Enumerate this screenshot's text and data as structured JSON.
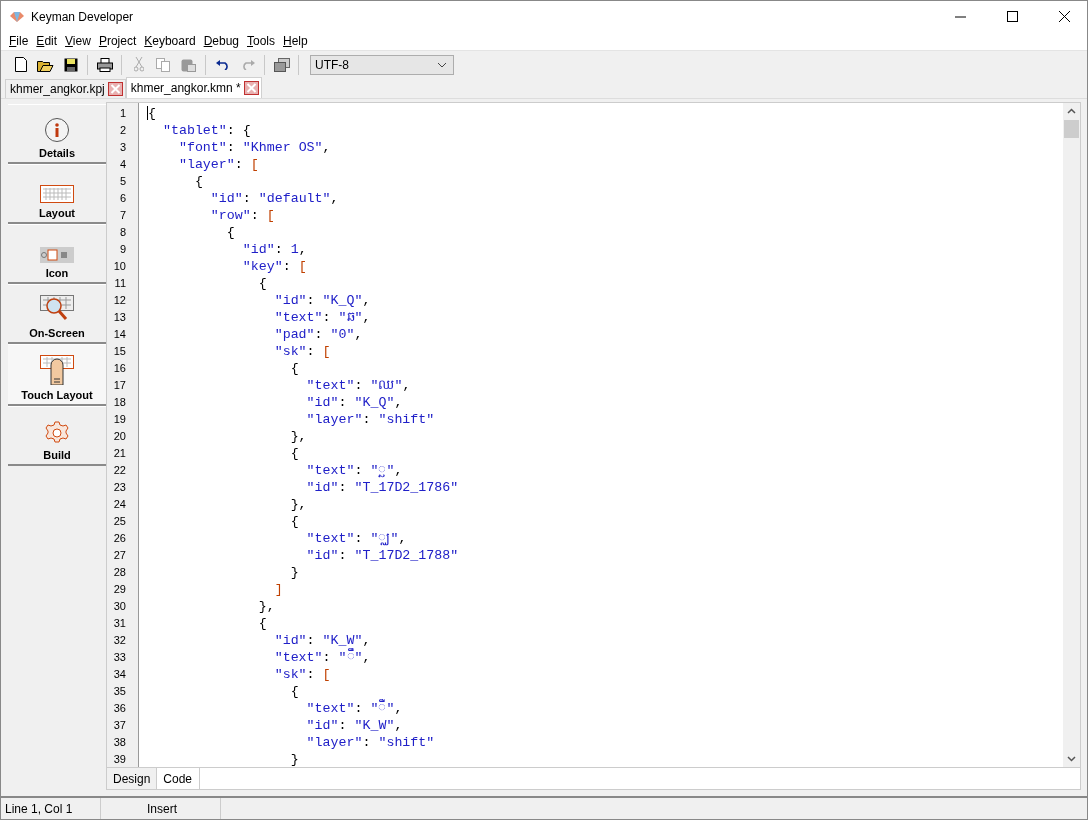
{
  "window": {
    "title": "Keyman Developer"
  },
  "menu": [
    "File",
    "Edit",
    "View",
    "Project",
    "Keyboard",
    "Debug",
    "Tools",
    "Help"
  ],
  "toolbar": {
    "encoding": "UTF-8"
  },
  "file_tabs": [
    {
      "label": "khmer_angkor.kpj",
      "selected": false
    },
    {
      "label": "khmer_angkor.kmn *",
      "selected": true
    }
  ],
  "sidebar": [
    {
      "label": "Details",
      "kind": "info",
      "selected": false
    },
    {
      "label": "Layout",
      "kind": "keyboard",
      "selected": false
    },
    {
      "label": "Icon",
      "kind": "icon",
      "selected": false
    },
    {
      "label": "On-Screen",
      "kind": "onscreen",
      "selected": false
    },
    {
      "label": "Touch Layout",
      "kind": "touch",
      "selected": true
    },
    {
      "label": "Build",
      "kind": "build",
      "selected": false
    }
  ],
  "editor": {
    "lines": [
      {
        "number": "1",
        "code": "{"
      },
      {
        "number": "2",
        "code": "  \"tablet\": {"
      },
      {
        "number": "3",
        "code": "    \"font\": \"Khmer OS\","
      },
      {
        "number": "4",
        "code": "    \"layer\": ["
      },
      {
        "number": "5",
        "code": "      {"
      },
      {
        "number": "6",
        "code": "        \"id\": \"default\","
      },
      {
        "number": "7",
        "code": "        \"row\": ["
      },
      {
        "number": "8",
        "code": "          {"
      },
      {
        "number": "9",
        "code": "            \"id\": 1,"
      },
      {
        "number": "10",
        "code": "            \"key\": ["
      },
      {
        "number": "11",
        "code": "              {"
      },
      {
        "number": "12",
        "code": "                \"id\": \"K_Q\","
      },
      {
        "number": "13",
        "code": "                \"text\": \"ឆ\","
      },
      {
        "number": "14",
        "code": "                \"pad\": \"0\","
      },
      {
        "number": "15",
        "code": "                \"sk\": ["
      },
      {
        "number": "16",
        "code": "                  {"
      },
      {
        "number": "17",
        "code": "                    \"text\": \"ឈ\","
      },
      {
        "number": "18",
        "code": "                    \"id\": \"K_Q\","
      },
      {
        "number": "19",
        "code": "                    \"layer\": \"shift\""
      },
      {
        "number": "20",
        "code": "                  },"
      },
      {
        "number": "21",
        "code": "                  {"
      },
      {
        "number": "22",
        "code": "                    \"text\": \"្ឆ\","
      },
      {
        "number": "23",
        "code": "                    \"id\": \"T_17D2_1786\""
      },
      {
        "number": "24",
        "code": "                  },"
      },
      {
        "number": "25",
        "code": "                  {"
      },
      {
        "number": "26",
        "code": "                    \"text\": \"្ឈ\","
      },
      {
        "number": "27",
        "code": "                    \"id\": \"T_17D2_1788\""
      },
      {
        "number": "28",
        "code": "                  }"
      },
      {
        "number": "29",
        "code": "                ]"
      },
      {
        "number": "30",
        "code": "              },"
      },
      {
        "number": "31",
        "code": "              {"
      },
      {
        "number": "32",
        "code": "                \"id\": \"K_W\","
      },
      {
        "number": "33",
        "code": "                \"text\": \"ឹ\","
      },
      {
        "number": "34",
        "code": "                \"sk\": ["
      },
      {
        "number": "35",
        "code": "                  {"
      },
      {
        "number": "36",
        "code": "                    \"text\": \"ឺ\","
      },
      {
        "number": "37",
        "code": "                    \"id\": \"K_W\","
      },
      {
        "number": "38",
        "code": "                    \"layer\": \"shift\""
      },
      {
        "number": "39",
        "code": "                  }"
      }
    ]
  },
  "view_tabs": [
    {
      "label": "Design",
      "selected": false
    },
    {
      "label": "Code",
      "selected": true
    }
  ],
  "status_bar": [
    "Line 1, Col 1",
    "Insert"
  ]
}
